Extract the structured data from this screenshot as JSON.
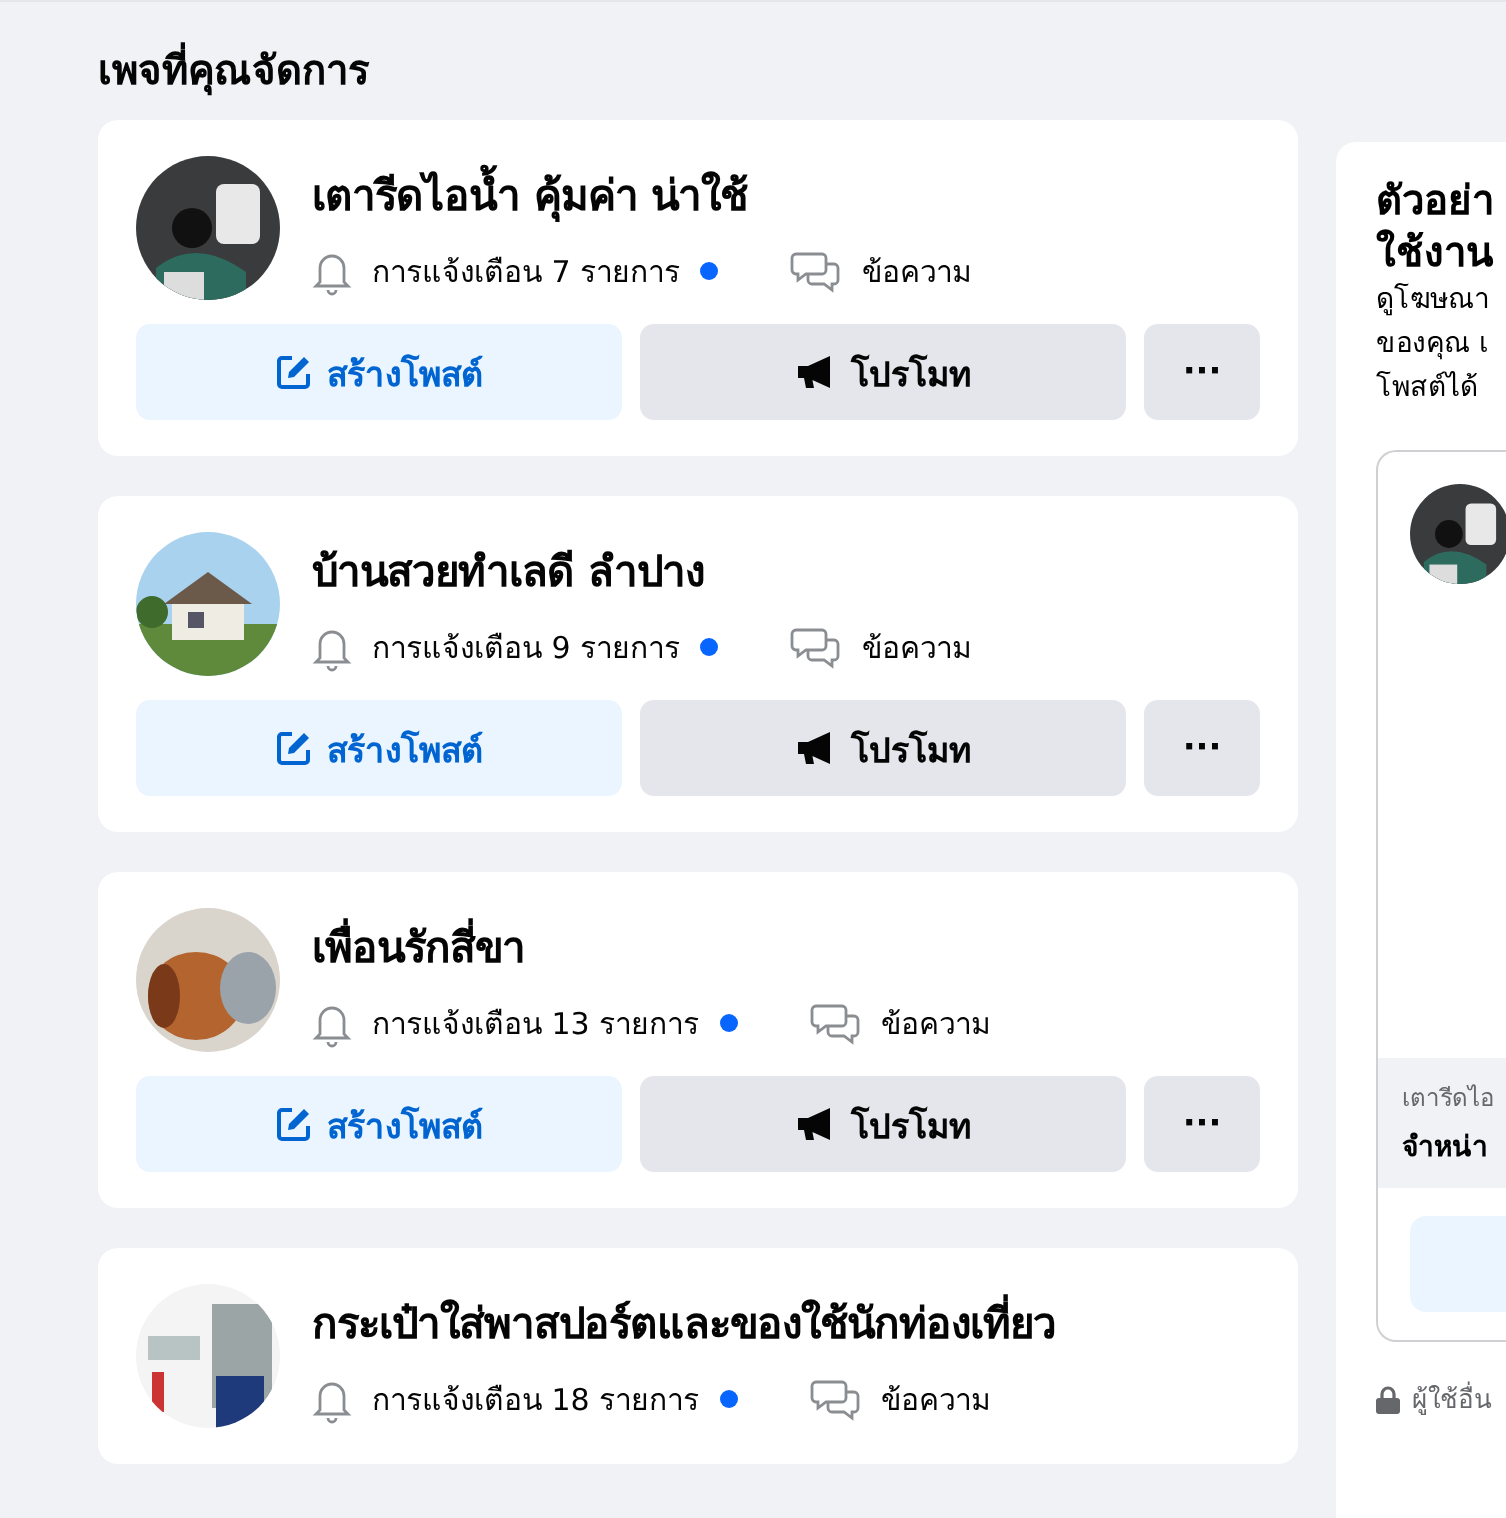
{
  "heading": "เพจที่คุณจัดการ",
  "pages": [
    {
      "name": "เตารีดไอน้ำ คุ้มค่า น่าใช้",
      "notifications": "การแจ้งเตือน 7 รายการ",
      "unread": true,
      "messages": "ข้อความ",
      "buttons": {
        "create": "สร้างโพสต์",
        "promote": "โปรโมท",
        "more": "···"
      }
    },
    {
      "name": "บ้านสวยทำเลดี ลำปาง",
      "notifications": "การแจ้งเตือน 9 รายการ",
      "unread": true,
      "messages": "ข้อความ",
      "buttons": {
        "create": "สร้างโพสต์",
        "promote": "โปรโมท",
        "more": "···"
      }
    },
    {
      "name": "เพื่อนรักสี่ขา",
      "notifications": "การแจ้งเตือน 13 รายการ",
      "unread": true,
      "messages": "ข้อความ",
      "buttons": {
        "create": "สร้างโพสต์",
        "promote": "โปรโมท",
        "more": "···"
      }
    },
    {
      "name": "กระเป๋าใส่พาสปอร์ตและของใช้นักท่องเที่ยว",
      "notifications": "การแจ้งเตือน 18 รายการ",
      "unread": true,
      "messages": "ข้อความ"
    }
  ],
  "preview": {
    "title_lines": [
      "ตัวอย่า",
      "ใช้งาน"
    ],
    "description_lines": [
      "ดูโฆษณา",
      "ของคุณ เ",
      "โพสต์ได้"
    ],
    "ad_page": "เตารีดไอ",
    "ad_text": "จำหน่า",
    "privacy": "ผู้ใช้อื่น"
  }
}
